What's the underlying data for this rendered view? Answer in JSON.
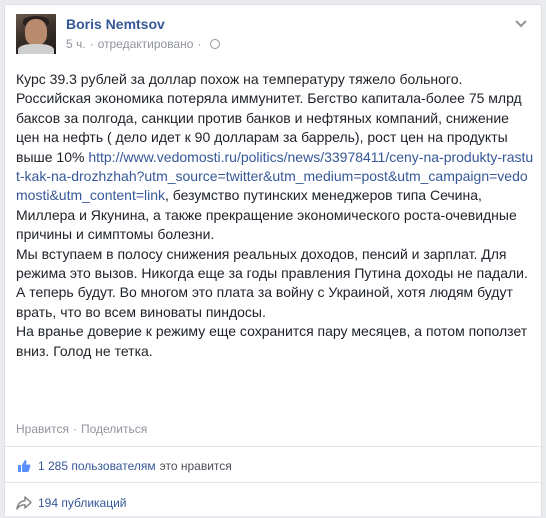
{
  "post": {
    "author": "Boris Nemtsov",
    "time": "5 ч.",
    "edited": "отредактировано",
    "separator": "·",
    "paragraphs": [
      {
        "parts": [
          {
            "text": "Курс 39.3 рублей за доллар похож на температуру тяжело больного. Российская экономика потеряла иммунитет. Бегство капитала-более 75 млрд баксов за полгода, санкции против банков и нефтяных компаний, снижение цен на нефть ( дело идет к 90 долларам за баррель), рост цен на продукты выше 10% "
          },
          {
            "link": "http://www.vedomosti.ru/politics/news/33978411/ceny-na-produkty-rastut-kak-na-drozhzhah?utm_source=twitter&utm_medium=post&utm_campaign=vedomosti&utm_content=link"
          },
          {
            "text": ", безумство путинских менеджеров типа Сечина, Миллера и Якунина, а также прекращение экономического роста-очевидные причины и симптомы болезни."
          }
        ]
      },
      {
        "parts": [
          {
            "text": "Мы вступаем в полосу снижения реальных доходов, пенсий и зарплат. Для режима это вызов. Никогда еще за годы правления Путина доходы не падали. А теперь будут. Во многом это плата за войну с Украиной, хотя людям будут врать, что во всем виноваты пиндосы."
          }
        ]
      },
      {
        "parts": [
          {
            "text": "На вранье доверие к режиму еще сохранится пару месяцев, а потом поползет вниз. Голод не тетка."
          }
        ]
      }
    ]
  },
  "actions": {
    "like": "Нравится",
    "dot": "·",
    "share": "Поделиться"
  },
  "likes": {
    "count": "1 285 пользователям",
    "suffix": "это нравится"
  },
  "shares": {
    "count": "194 публикаций"
  },
  "colors": {
    "link": "#365899",
    "muted": "#90949c",
    "text": "#1d2129"
  },
  "icons": {
    "menu": "chevron-down-icon",
    "privacy": "globe-icon",
    "like": "thumbs-up-icon",
    "share": "share-arrow-icon"
  }
}
